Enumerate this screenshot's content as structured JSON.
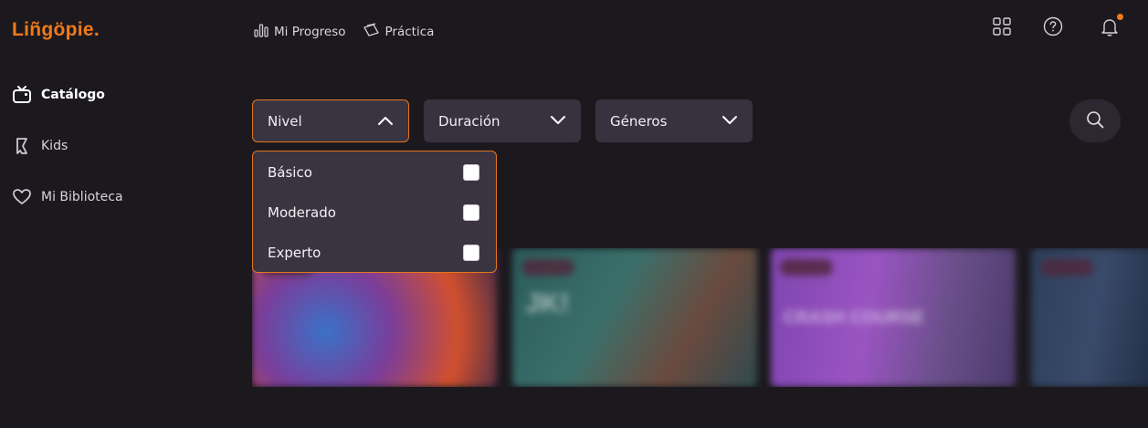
{
  "brand": {
    "logo_text": "Liñgöpie.",
    "accent": "#f07a1a"
  },
  "sidebar": {
    "items": [
      {
        "label": "Catálogo",
        "icon": "tv-icon",
        "active": true
      },
      {
        "label": "Kids",
        "icon": "kids-icon",
        "active": false
      },
      {
        "label": "Mi Biblioteca",
        "icon": "heart-icon",
        "active": false
      }
    ]
  },
  "topnav": {
    "links": [
      {
        "label": "Mi Progreso",
        "icon": "bar-chart-icon"
      },
      {
        "label": "Práctica",
        "icon": "flashcards-icon"
      }
    ],
    "right_icons": [
      "apps-grid-icon",
      "help-icon",
      "bell-icon"
    ]
  },
  "filters": {
    "nivel": {
      "label": "Nivel",
      "expanded": true
    },
    "duracion": {
      "label": "Duración",
      "expanded": false
    },
    "generos": {
      "label": "Géneros",
      "expanded": false
    }
  },
  "dropdown": {
    "options": [
      {
        "label": "Básico",
        "checked": false
      },
      {
        "label": "Moderado",
        "checked": false
      },
      {
        "label": "Experto",
        "checked": false
      }
    ]
  },
  "cards": [
    {
      "text": ""
    },
    {
      "text": "JK!"
    },
    {
      "text": "CRASH COURSE"
    },
    {
      "text": ""
    }
  ]
}
